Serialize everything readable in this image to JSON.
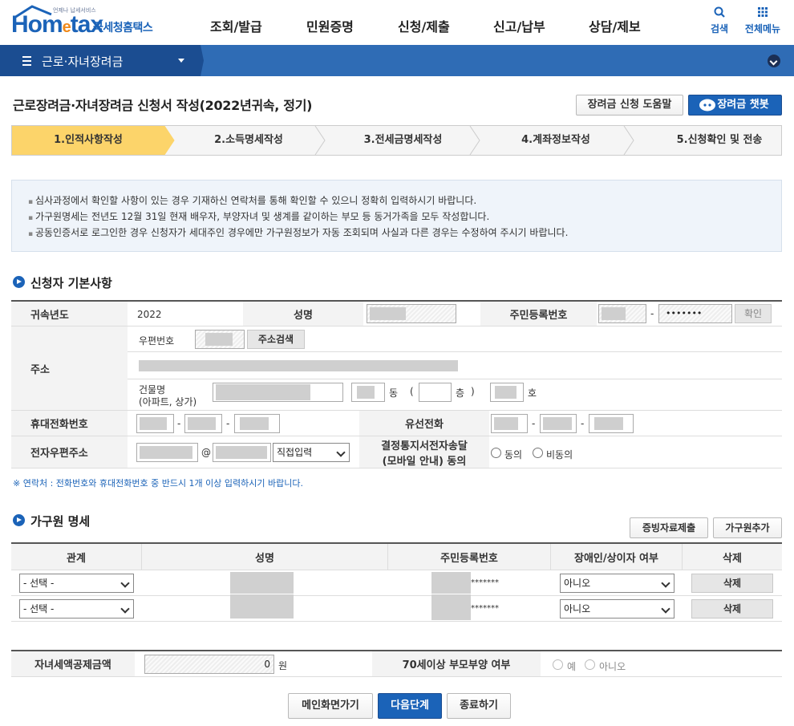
{
  "header": {
    "logo_sub": "언제나 납세서비스",
    "logo_text": "Hometax",
    "logo_kr": "국세청홈택스",
    "menu": [
      "조회/발급",
      "민원증명",
      "신청/제출",
      "신고/납부",
      "상담/제보"
    ],
    "search_label": "검색",
    "allmenu_label": "전체메뉴"
  },
  "location": {
    "title": "근로·자녀장려금"
  },
  "page": {
    "title": "근로장려금·자녀장려금 신청서 작성(2022년귀속, 정기)",
    "help_button": "장려금 신청 도움말",
    "chatbot_button": "장려금 챗봇"
  },
  "steps": [
    "1.인적사항작성",
    "2.소득명세작성",
    "3.전세금명세작성",
    "4.계좌정보작성",
    "5.신청확인 및 전송"
  ],
  "notice": [
    "심사과정에서 확인할 사항이 있는 경우 기재하신 연락처를 통해 확인할 수 있으니 정확히 입력하시기 바랍니다.",
    "가구원명세는 전년도 12월 31일 현재 배우자, 부양자녀 및 생계를 같이하는 부모 등 동거가족을 모두 작성합니다.",
    "공동인증서로 로그인한 경우 신청자가 세대주인 경우에만 가구원정보가 자동 조회되며 사실과 다른 경우는 수정하여 주시기 바랍니다."
  ],
  "applicant": {
    "section_title": "신청자 기본사항",
    "year_label": "귀속년도",
    "year_value": "2022",
    "name_label": "성명",
    "rrn_label": "주민등록번호",
    "rrn_mask": "•••••••",
    "confirm_button": "확인",
    "address_label": "주소",
    "postcode_label": "우편번호",
    "address_search_button": "주소검색",
    "building_label": "건물명",
    "building_hint": "(아파트, 상가)",
    "dong_label": "동",
    "paren_open": "(",
    "floor_label": "층",
    "paren_close": ")",
    "ho_label": "호",
    "mobile_label": "휴대전화번호",
    "phone_label": "유선전화",
    "email_label": "전자우편주소",
    "email_at": "@",
    "email_domain_select": "직접입력",
    "notify_label_1": "결정통지서전자송달",
    "notify_label_2": "(모바일 안내) 동의",
    "agree_label": "동의",
    "disagree_label": "비동의",
    "dash": "-"
  },
  "contact_note": "※ 연락처 : 전화번호와 휴대전화번호 중 반드시 1개 이상 입력하시기 바랍니다.",
  "household": {
    "section_title": "가구원 명세",
    "evidence_button": "증빙자료제출",
    "add_button": "가구원추가",
    "columns": [
      "관계",
      "성명",
      "주민등록번호",
      "장애인/상이자 여부",
      "삭제"
    ],
    "rows": [
      {
        "relation": "- 선택 -",
        "rrn_tail": "*******",
        "disabled": "아니오",
        "delete": "삭제"
      },
      {
        "relation": "- 선택 -",
        "rrn_tail": "*******",
        "disabled": "아니오",
        "delete": "삭제"
      }
    ]
  },
  "deduction": {
    "child_credit_label": "자녀세액공제금액",
    "child_credit_value": "0",
    "won": "원",
    "parent_label": "70세이상 부모부양 여부",
    "yes_label": "예",
    "no_label": "아니오"
  },
  "footer": {
    "main_button": "메인화면가기",
    "next_button": "다음단계",
    "exit_button": "종료하기"
  },
  "colors": {
    "brand": "#1b63b8",
    "location_bar": "#2f6cb5",
    "active_step": "#fcd46a"
  }
}
